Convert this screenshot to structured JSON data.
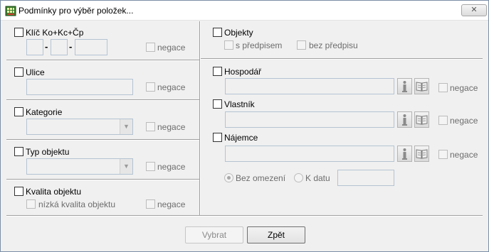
{
  "window": {
    "title": "Podmínky pro výběr položek...",
    "close_label": "✕"
  },
  "left": {
    "klic": {
      "label": "Klíč Ko+Kc+Čp",
      "separator1": "-",
      "separator2": "-",
      "negace": "negace"
    },
    "ulice": {
      "label": "Ulice",
      "negace": "negace"
    },
    "kategorie": {
      "label": "Kategorie",
      "negace": "negace"
    },
    "typ_objektu": {
      "label": "Typ objektu",
      "negace": "negace"
    },
    "kvalita": {
      "label": "Kvalita objektu",
      "sub_option": "nízká kvalita objektu",
      "negace": "negace"
    }
  },
  "right": {
    "objekty": {
      "label": "Objekty",
      "opt1": "s předpisem",
      "opt2": "bez předpisu"
    },
    "hospodar": {
      "label": "Hospodář",
      "negace": "negace"
    },
    "vlastnik": {
      "label": "Vlastník",
      "negace": "negace"
    },
    "najemce": {
      "label": "Nájemce",
      "negace": "negace"
    },
    "radio": {
      "opt1": "Bez omezení",
      "opt2": "K datu",
      "selected": "Bez omezení"
    }
  },
  "buttons": {
    "select": "Vybrat",
    "back": "Zpět"
  },
  "icons": {
    "info": "info-icon",
    "book": "book-icon",
    "dropdown": "chevron-down-icon",
    "app": "app-grid-icon"
  }
}
